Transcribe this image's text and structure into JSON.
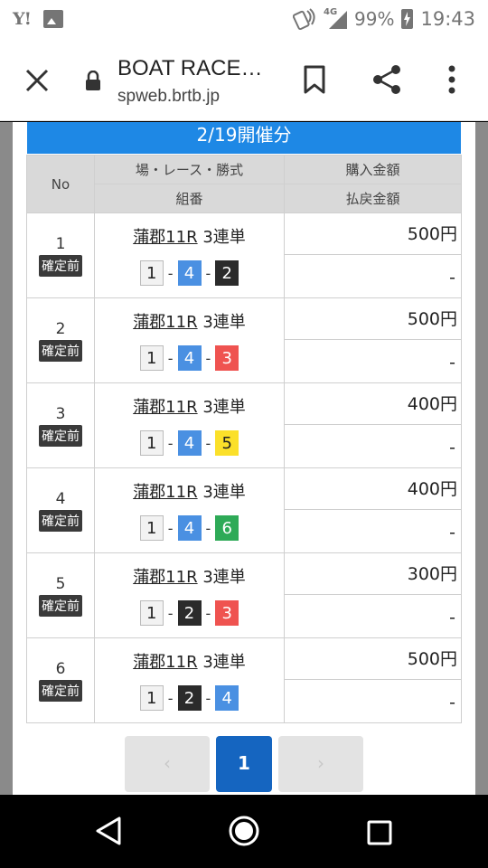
{
  "status": {
    "carrier_logo": "Y!",
    "network": "4G",
    "battery": "99%",
    "time": "19:43",
    "icons": [
      "yahoo-icon",
      "image-icon",
      "nfc-icon",
      "signal-icon",
      "battery-charging-icon"
    ]
  },
  "browser": {
    "title": "BOAT RACE…",
    "url": "spweb.brtb.jp",
    "icons": [
      "close-icon",
      "lock-icon",
      "bookmark-icon",
      "share-icon",
      "more-vert-icon"
    ]
  },
  "banner": "2/19開催分",
  "table": {
    "headers": {
      "no": "No",
      "race_top": "場・レース・勝式",
      "race_bottom": "組番",
      "amt_top": "購入金額",
      "amt_bottom": "払戻金額"
    },
    "rows": [
      {
        "no": "1",
        "status": "確定前",
        "race": "蒲郡11R",
        "bet_type": "3連単",
        "combo": [
          "1",
          "4",
          "2"
        ],
        "purchase": "500円",
        "payout": "-"
      },
      {
        "no": "2",
        "status": "確定前",
        "race": "蒲郡11R",
        "bet_type": "3連単",
        "combo": [
          "1",
          "4",
          "3"
        ],
        "purchase": "500円",
        "payout": "-"
      },
      {
        "no": "3",
        "status": "確定前",
        "race": "蒲郡11R",
        "bet_type": "3連単",
        "combo": [
          "1",
          "4",
          "5"
        ],
        "purchase": "400円",
        "payout": "-"
      },
      {
        "no": "4",
        "status": "確定前",
        "race": "蒲郡11R",
        "bet_type": "3連単",
        "combo": [
          "1",
          "4",
          "6"
        ],
        "purchase": "400円",
        "payout": "-"
      },
      {
        "no": "5",
        "status": "確定前",
        "race": "蒲郡11R",
        "bet_type": "3連単",
        "combo": [
          "1",
          "2",
          "3"
        ],
        "purchase": "300円",
        "payout": "-"
      },
      {
        "no": "6",
        "status": "確定前",
        "race": "蒲郡11R",
        "bet_type": "3連単",
        "combo": [
          "1",
          "2",
          "4"
        ],
        "purchase": "500円",
        "payout": "-"
      }
    ],
    "separator": "-"
  },
  "boat_colors": {
    "1": {
      "bg": "#f2f2f2",
      "fg": "#222222"
    },
    "2": {
      "bg": "#2b2b2b",
      "fg": "#ffffff"
    },
    "3": {
      "bg": "#ef5350",
      "fg": "#ffffff"
    },
    "4": {
      "bg": "#4a90e2",
      "fg": "#ffffff"
    },
    "5": {
      "bg": "#fbe02a",
      "fg": "#222222"
    },
    "6": {
      "bg": "#2eaa57",
      "fg": "#ffffff"
    }
  },
  "pager": {
    "prev": "‹",
    "current": "1",
    "next": "›"
  },
  "colors": {
    "accent": "#1e88e5",
    "pager_active": "#1565c0"
  },
  "nav_icons": [
    "back-icon",
    "home-icon",
    "recents-icon"
  ]
}
